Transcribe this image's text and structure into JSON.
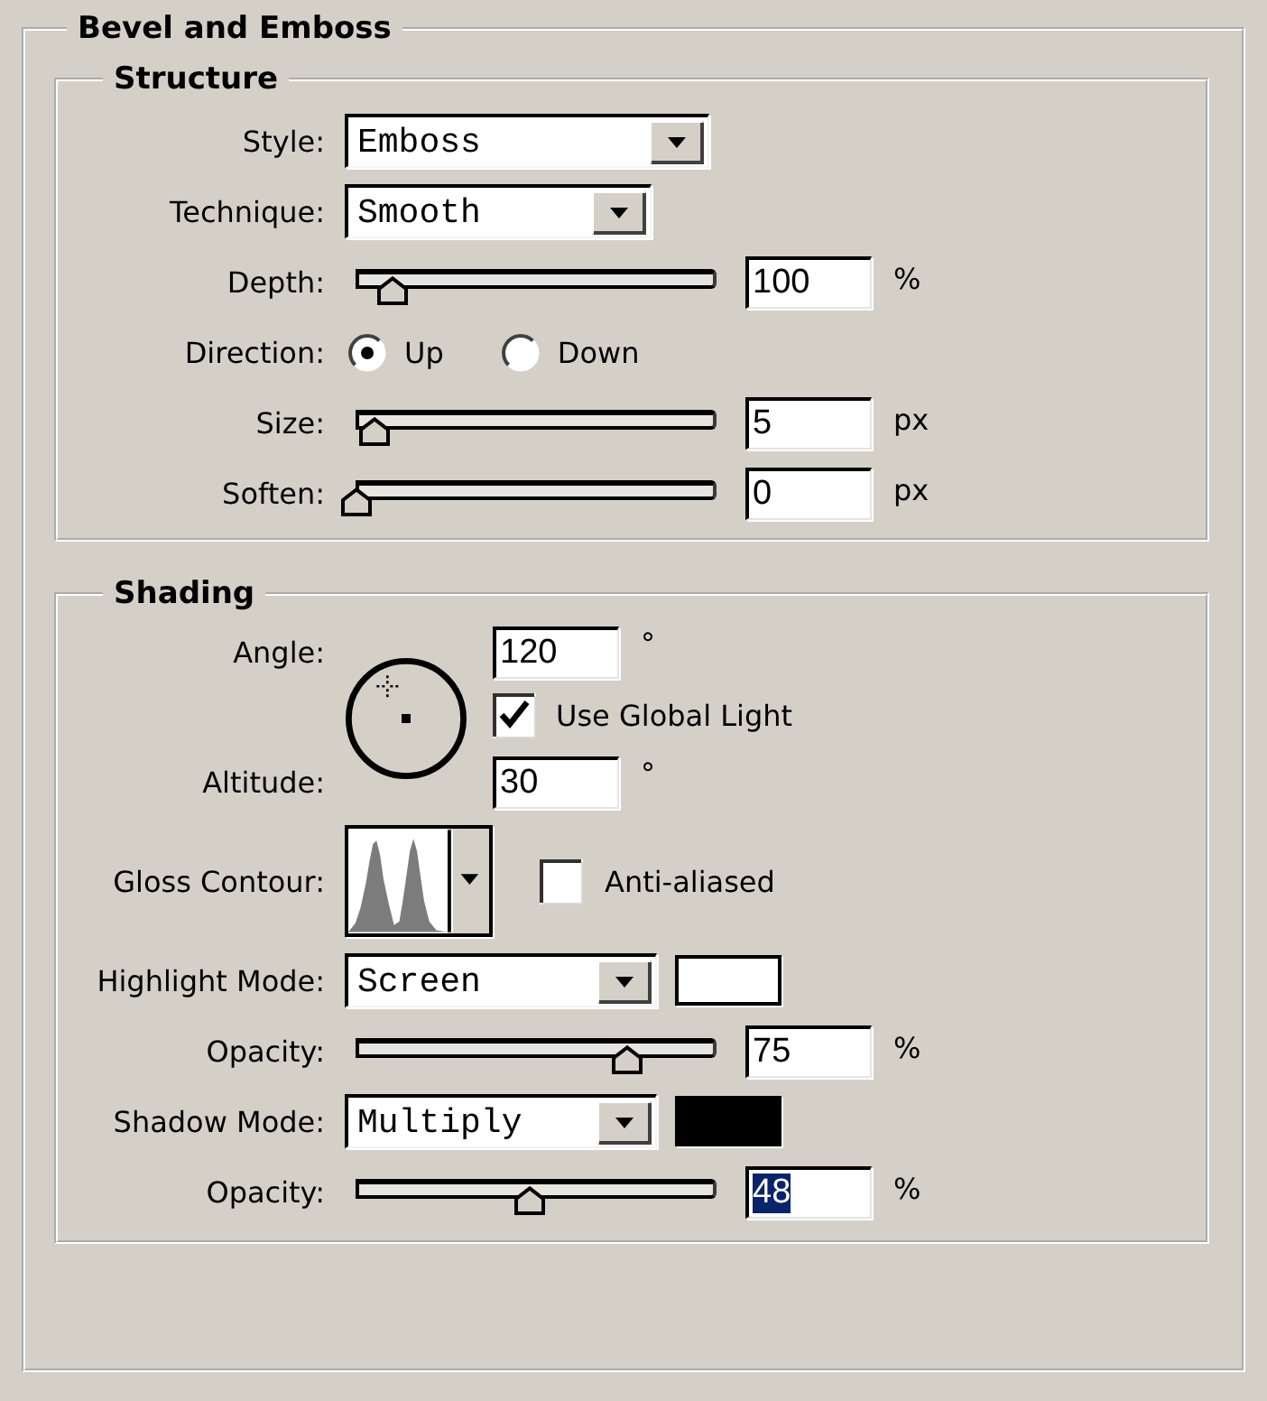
{
  "panel": {
    "title": "Bevel and Emboss"
  },
  "sections": [
    {
      "title": "Structure",
      "rows": [
        {
          "kind": "dropdown",
          "label": "Style:",
          "value": "Emboss"
        },
        {
          "kind": "dropdown",
          "label": "Technique:",
          "value": "Smooth"
        },
        {
          "kind": "slider",
          "label": "Depth:",
          "level": 0.1,
          "value": "100",
          "unit": "%",
          "text_selected": false
        },
        {
          "kind": "radio",
          "label": "Direction:",
          "options": [
            {
              "label": "Up",
              "selected": true
            },
            {
              "label": "Down",
              "selected": false
            }
          ]
        },
        {
          "kind": "slider",
          "label": "Size:",
          "level": 0.05,
          "value": "5",
          "unit": "px",
          "text_selected": false
        },
        {
          "kind": "slider",
          "label": "Soften:",
          "level": 0,
          "value": "0",
          "unit": "px",
          "text_selected": false
        }
      ]
    },
    {
      "title": "Shading",
      "rows": [
        {
          "kind": "light",
          "angle": {
            "label": "Angle:",
            "value": "120",
            "unit": "°"
          },
          "global_light": {
            "label": "Use Global Light",
            "checked": true
          },
          "altitude": {
            "label": "Altitude:",
            "value": "30",
            "unit": "°"
          }
        },
        {
          "kind": "contour",
          "label": "Gloss Contour:",
          "anti_aliased": {
            "label": "Anti-aliased",
            "checked": false
          }
        },
        {
          "kind": "dropdown",
          "label": "Highlight Mode:",
          "value": "Screen",
          "color": "#ffffff"
        },
        {
          "kind": "slider",
          "label": "Opacity:",
          "level": 0.75,
          "value": "75",
          "unit": "%",
          "text_selected": false
        },
        {
          "kind": "dropdown",
          "label": "Shadow Mode:",
          "value": "Multiply",
          "color": "#000000"
        },
        {
          "kind": "slider",
          "label": "Opacity:",
          "level": 0.48,
          "value": "48",
          "unit": "%",
          "text_selected": true
        }
      ]
    }
  ]
}
